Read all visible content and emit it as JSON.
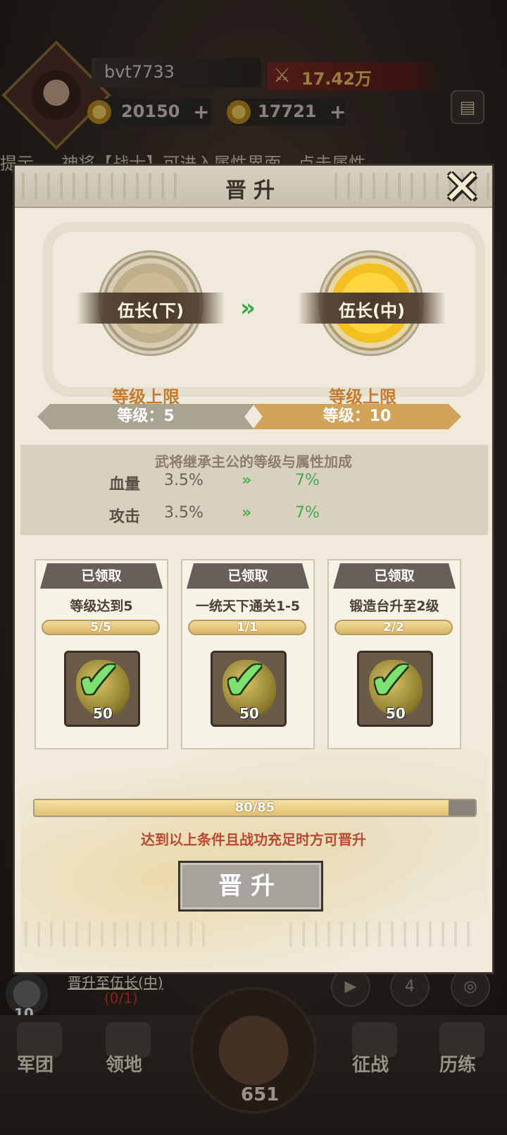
{
  "player": {
    "name": "bvt7733",
    "power": "17.42万",
    "ingots": "20150",
    "coins": "17721",
    "plus": "+"
  },
  "ticker": "提示 … 神将【战士】可进入属性界面，点击属性",
  "quest": {
    "title": "晋升至伍长(中)",
    "progress": "(0/1)",
    "count": "10",
    "badge_num": "4"
  },
  "nav": {
    "items": [
      "军团",
      "领地",
      "征战",
      "历练"
    ],
    "forge_count": "651"
  },
  "modal": {
    "title": "晋升",
    "close_glyph": "✕",
    "current_rank": "伍长(下)",
    "next_rank": "伍长(中)",
    "arrow": "»",
    "limit_label": "等级上限",
    "current_level": "等级：5",
    "next_level": "等级：10",
    "bonus": {
      "title": "武将继承主公的等级与属性加成",
      "rows": [
        {
          "label": "血量",
          "from": "3.5%",
          "to": "7%"
        },
        {
          "label": "攻击",
          "from": "3.5%",
          "to": "7%"
        }
      ]
    },
    "conditions": [
      {
        "status": "已领取",
        "text": "等级达到5",
        "progress": "5/5",
        "reward_qty": "50"
      },
      {
        "status": "已领取",
        "text": "一统天下通关1-5",
        "progress": "1/1",
        "reward_qty": "50"
      },
      {
        "status": "已领取",
        "text": "锻造台升至2级",
        "progress": "2/2",
        "reward_qty": "50"
      }
    ],
    "merit": {
      "text": "80/85",
      "fraction": 0.94
    },
    "hint": "达到以上条件且战功充足时方可晋升",
    "promote_label": "晋升"
  },
  "colors": {
    "accent_gold": "#d2a35a",
    "green_up": "#4aa850",
    "hint_red": "#b84a34"
  }
}
